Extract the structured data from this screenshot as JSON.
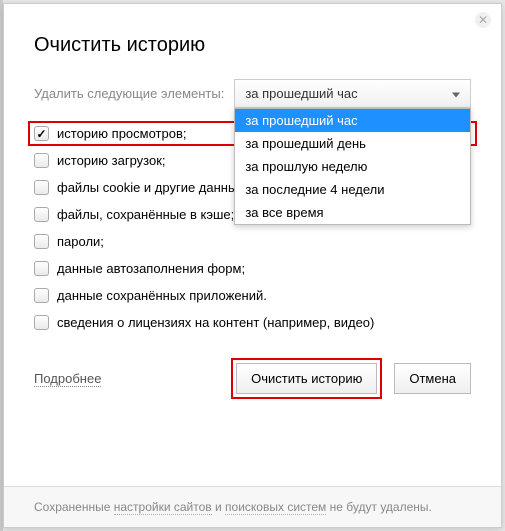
{
  "dialog": {
    "title": "Очистить историю",
    "close_icon": "✕",
    "dropdown_label": "Удалить следующие элементы:",
    "dropdown_selected": "за прошедший час",
    "dropdown_options": [
      "за прошедший час",
      "за прошедший день",
      "за прошлую неделю",
      "за последние 4 недели",
      "за все время"
    ],
    "checks": [
      {
        "label": "историю просмотров;",
        "checked": true,
        "highlighted": true
      },
      {
        "label": "историю загрузок;",
        "checked": false,
        "highlighted": false
      },
      {
        "label": "файлы cookie и другие данные сайтов и модулей;",
        "checked": false,
        "highlighted": false
      },
      {
        "label": "файлы, сохранённые в кэше;",
        "checked": false,
        "highlighted": false
      },
      {
        "label": "пароли;",
        "checked": false,
        "highlighted": false
      },
      {
        "label": "данные автозаполнения форм;",
        "checked": false,
        "highlighted": false
      },
      {
        "label": "данные сохранённых приложений.",
        "checked": false,
        "highlighted": false
      },
      {
        "label": "сведения о лицензиях на контент (например, видео)",
        "checked": false,
        "highlighted": false
      }
    ],
    "more_link": "Подробнее",
    "primary_button": "Очистить историю",
    "cancel_button": "Отмена",
    "footer_prefix": "Сохраненные ",
    "footer_link1": "настройки сайтов",
    "footer_mid": " и ",
    "footer_link2": "поисковых систем",
    "footer_suffix": " не будут удалены."
  }
}
